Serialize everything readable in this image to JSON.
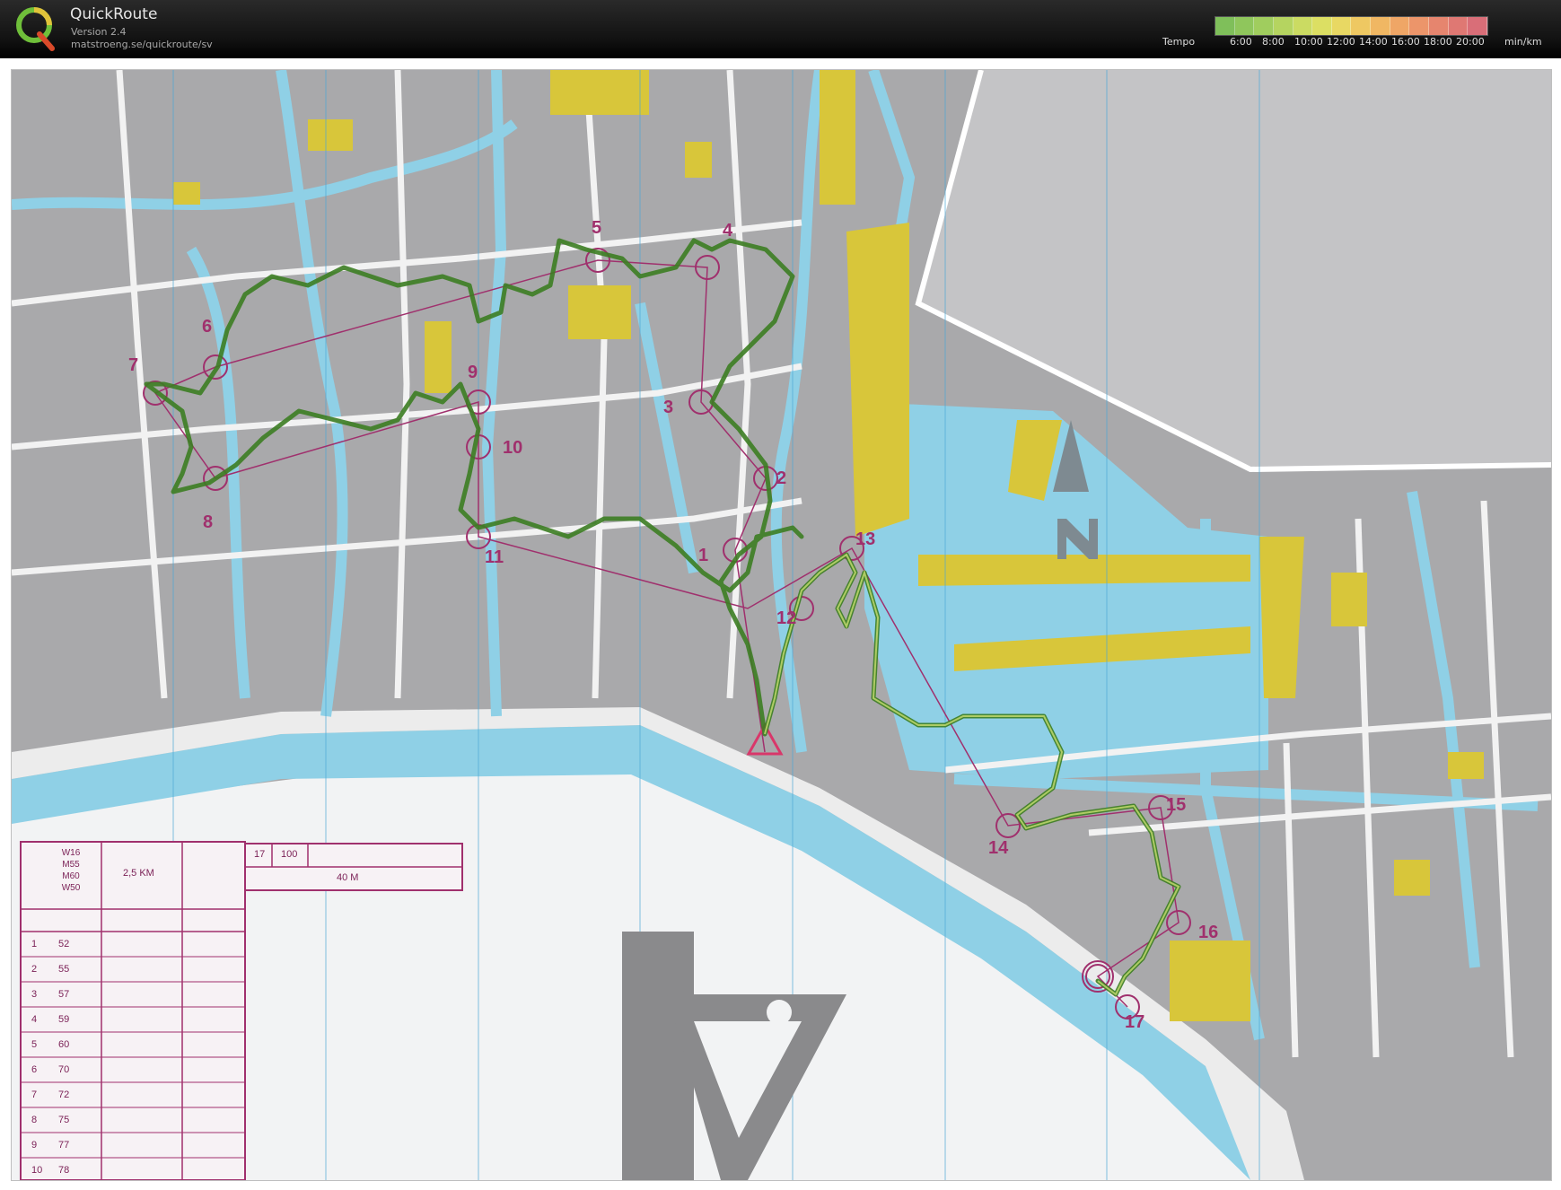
{
  "app": {
    "name": "QuickRoute",
    "version": "Version 2.4",
    "url": "matstroeng.se/quickroute/sv",
    "logo_letter": "Q"
  },
  "tempo": {
    "label": "Tempo",
    "ticks": [
      "6:00",
      "8:00",
      "10:00",
      "12:00",
      "14:00",
      "16:00",
      "18:00",
      "20:00"
    ],
    "unit": "min/km",
    "colors": [
      "#7fbf5a",
      "#8fc65c",
      "#a0cd5e",
      "#b5d460",
      "#cbdb62",
      "#dcdf63",
      "#e8d863",
      "#eec862",
      "#f0b763",
      "#efa666",
      "#ec956a",
      "#e6856e",
      "#df7873",
      "#d96e78"
    ]
  },
  "map": {
    "controls": [
      "1",
      "2",
      "3",
      "4",
      "5",
      "6",
      "7",
      "8",
      "9",
      "10",
      "11",
      "12",
      "13",
      "14",
      "15",
      "16",
      "17"
    ],
    "legend": {
      "classes": [
        "W16",
        "M55",
        "M60",
        "W50"
      ],
      "distance": "2,5 KM",
      "finish_code": "17",
      "finish_distance": "100",
      "finish_length": "40 M",
      "rows": [
        {
          "num": "1",
          "code": "52"
        },
        {
          "num": "2",
          "code": "55"
        },
        {
          "num": "3",
          "code": "57"
        },
        {
          "num": "4",
          "code": "59"
        },
        {
          "num": "5",
          "code": "60"
        },
        {
          "num": "6",
          "code": "70"
        },
        {
          "num": "7",
          "code": "72"
        },
        {
          "num": "8",
          "code": "75"
        },
        {
          "num": "9",
          "code": "77"
        },
        {
          "num": "10",
          "code": "78"
        }
      ]
    },
    "colors": {
      "water": "#8fd0e6",
      "building": "#9d9d9f",
      "street": "#f2f2f2",
      "yellow": "#d8c63a",
      "course": "#a0306d",
      "route": "#4a8f2a"
    }
  }
}
